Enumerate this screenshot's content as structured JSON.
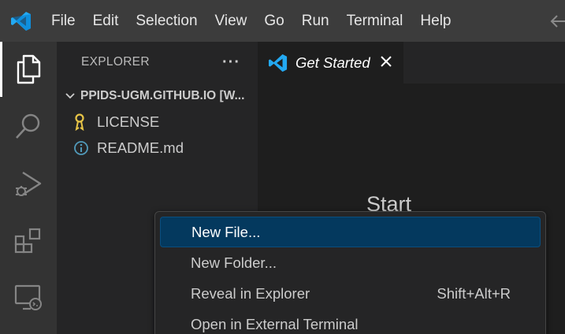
{
  "menu": {
    "items": [
      "File",
      "Edit",
      "Selection",
      "View",
      "Go",
      "Run",
      "Terminal",
      "Help"
    ]
  },
  "sidebar": {
    "title": "EXPLORER",
    "more_actions": "···",
    "folder": "PPIDS-UGM.GITHUB.IO [W...",
    "files": [
      {
        "name": "LICENSE",
        "icon": "license-key-icon"
      },
      {
        "name": "README.md",
        "icon": "info-icon"
      }
    ]
  },
  "editor": {
    "tab_label": "Get Started",
    "start_heading": "Start"
  },
  "context_menu": {
    "items": [
      {
        "label": "New File...",
        "shortcut": ""
      },
      {
        "label": "New Folder...",
        "shortcut": ""
      },
      {
        "label": "Reveal in Explorer",
        "shortcut": "Shift+Alt+R"
      },
      {
        "label": "Open in External Terminal",
        "shortcut": ""
      }
    ]
  },
  "colors": {
    "accent": "#007acc",
    "selection": "#04395e",
    "title_bar": "#3c3c3c",
    "activity_bar": "#333333",
    "sidebar": "#252526",
    "editor": "#1e1e1e"
  }
}
